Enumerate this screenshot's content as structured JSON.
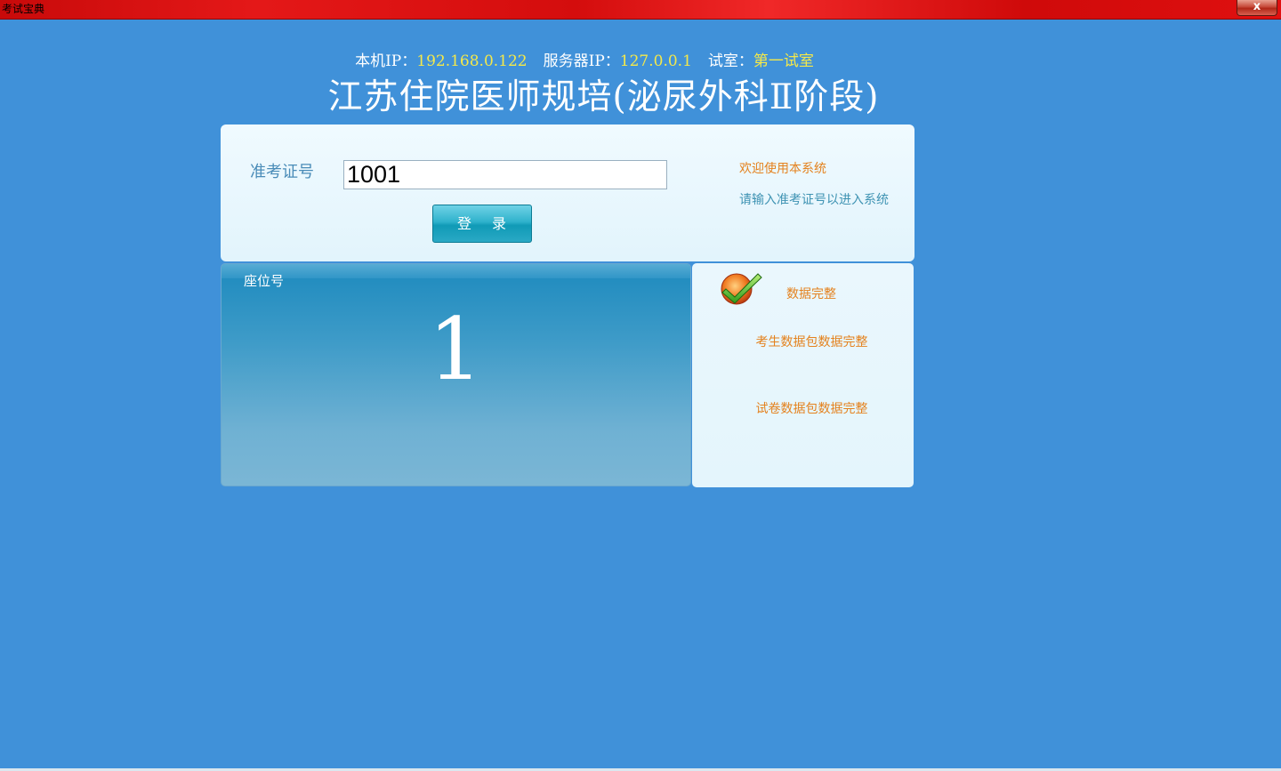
{
  "window": {
    "title": "考试宝典",
    "close_label": "x"
  },
  "header": {
    "local_ip_label": "本机IP：",
    "local_ip": "192.168.0.122",
    "server_ip_label": "服务器IP：",
    "server_ip": "127.0.0.1",
    "room_label": "试室：",
    "room": "第一试室",
    "title": "江苏住院医师规培(泌尿外科Ⅱ阶段)"
  },
  "login": {
    "label": "准考证号",
    "value": "1001",
    "button_label": "登 录",
    "welcome": "欢迎使用本系统",
    "hint": "请输入准考证号以进入系统"
  },
  "seat": {
    "label": "座位号",
    "number": "1"
  },
  "status": {
    "icon": "check-icon",
    "main": "数据完整",
    "student_package": "考生数据包数据完整",
    "paper_package": "试卷数据包数据完整"
  },
  "colors": {
    "background": "#4091d9",
    "titlebar": "#d40d0d",
    "accent_orange": "#e4821e",
    "highlight_yellow": "#f4e84a",
    "button_teal": "#1aa6c2"
  }
}
